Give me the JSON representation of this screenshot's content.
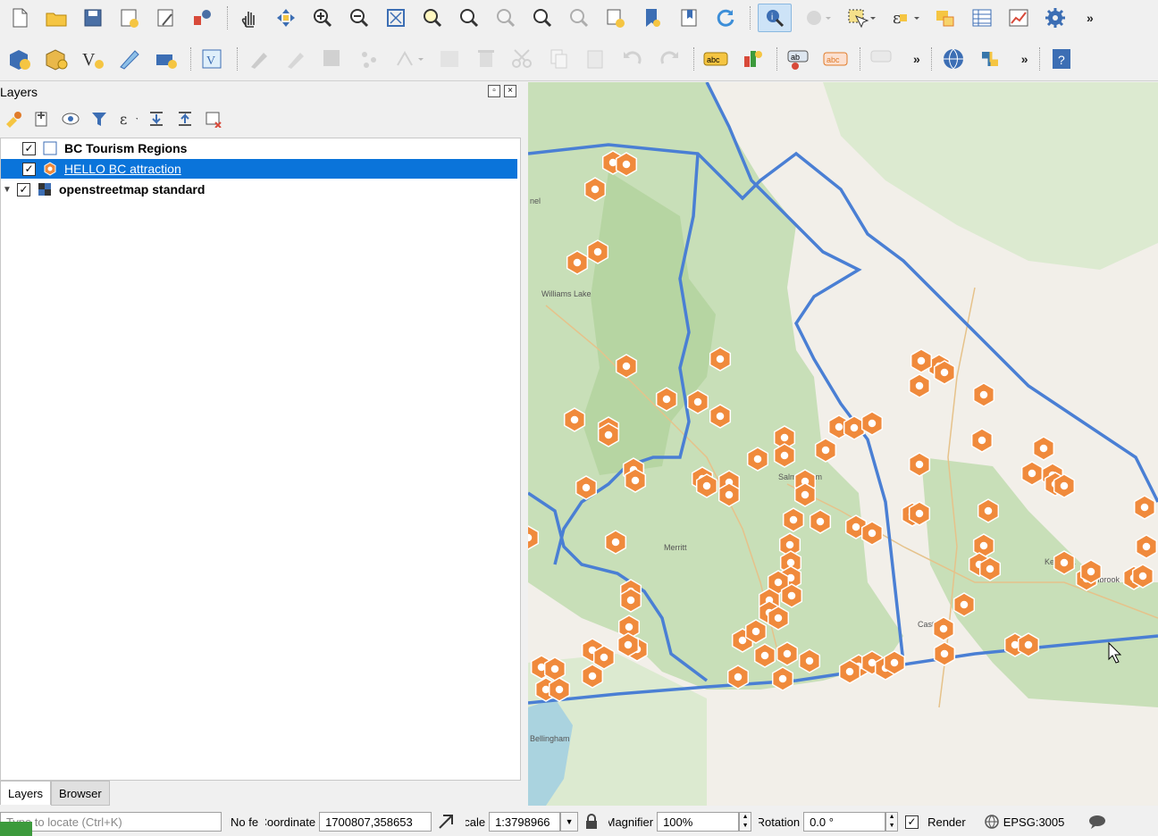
{
  "layers_panel": {
    "title": "Layers",
    "layers": [
      {
        "name": "BC Tourism Regions",
        "checked": "✓",
        "selected": false
      },
      {
        "name": "HELLO BC attraction",
        "checked": "✓",
        "selected": true
      },
      {
        "name": "openstreetmap standard",
        "checked": "✓",
        "selected": false
      }
    ],
    "tabs": [
      "Layers",
      "Browser"
    ]
  },
  "map": {
    "labels": [
      "nel",
      "Williams Lake",
      "Salmon Arm",
      "Merritt",
      "Kelowna",
      "Bellingham",
      "Castlegar",
      "Cranbrook"
    ],
    "colors": {
      "land": "#f2efe9",
      "forest": "#add19e",
      "boundary": "#4a7fd4",
      "poi": "#f08a3c"
    }
  },
  "statusbar": {
    "locate_placeholder": "Type to locate (Ctrl+K)",
    "no_features": "No fe",
    "coordinate_label": "Coordinate",
    "coordinate_value": "1700807,358653",
    "scale_label": "Scale",
    "scale_value": "1:3798966",
    "magnifier_label": "Magnifier",
    "magnifier_value": "100%",
    "rotation_label": "Rotation",
    "rotation_value": "0.0 °",
    "render_check": "✓",
    "render_label": "Render",
    "crs": "EPSG:3005"
  },
  "toolbar": {
    "more": "»"
  }
}
